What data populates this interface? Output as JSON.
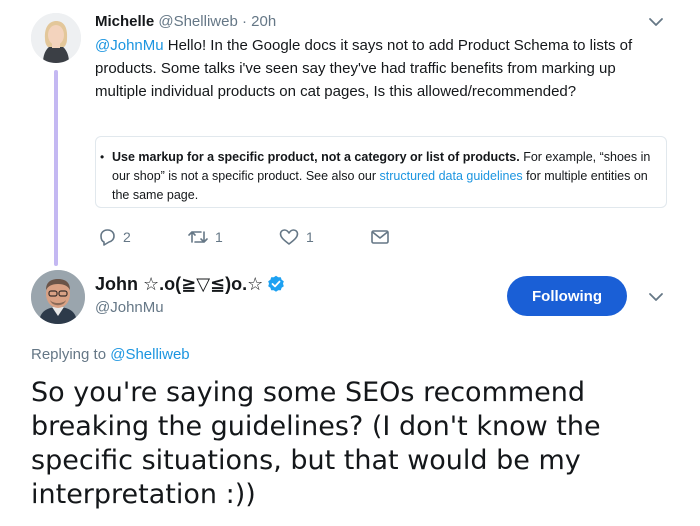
{
  "parent_tweet": {
    "author_name": "Michelle",
    "author_handle": "@Shelliweb",
    "separator": "·",
    "time": "20h",
    "mention": "@JohnMu",
    "text": " Hello! In the Google docs it says not to add Product Schema to lists of products. Some talks i've seen say they've had traffic benefits from marking up multiple individual products on cat pages, Is this allowed/recommended?",
    "quote": {
      "bullet": "•",
      "bold": "Use markup for a specific product, not a category or list of products.",
      "text_before_link": " For example, “shoes in our shop” is not a specific product. See also our ",
      "link": "structured data guidelines",
      "text_after_link": " for multiple entities on the same page."
    },
    "actions": {
      "replies": "2",
      "retweets": "1",
      "likes": "1"
    }
  },
  "main_tweet": {
    "author_name": "John ☆.o(≧▽≦)o.☆",
    "author_handle": "@JohnMu",
    "follow_label": "Following",
    "replying_prefix": "Replying to ",
    "replying_to": "@Shelliweb",
    "text": "So you're saying some SEOs recommend breaking the guidelines? (I don't know the specific situations, but that would be my interpretation :))"
  },
  "colors": {
    "accent": "#1b95e0",
    "follow_button": "#1a5fd6",
    "thread_line": "#c4b8f2",
    "muted": "#657786",
    "verified": "#1da1f2"
  },
  "icons": [
    "chevron-down-icon",
    "reply-icon",
    "retweet-icon",
    "like-icon",
    "message-icon",
    "verified-icon"
  ]
}
